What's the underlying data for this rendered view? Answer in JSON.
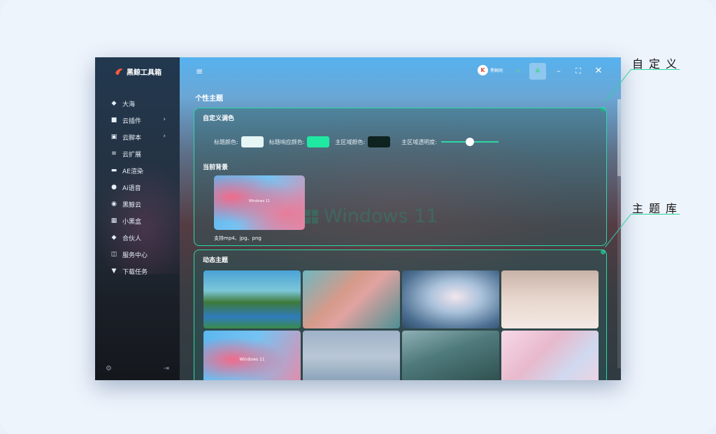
{
  "app": {
    "logo_text": "黑鲸工具箱",
    "brand_badge": "黑鲸网"
  },
  "sidebar": {
    "items": [
      {
        "label": "大海",
        "icon": "fish-icon"
      },
      {
        "label": "云插件",
        "icon": "cube-icon",
        "has_submenu": true
      },
      {
        "label": "云脚本",
        "icon": "code-icon",
        "has_submenu": true
      },
      {
        "label": "云扩展",
        "icon": "layers-icon"
      },
      {
        "label": "AE渲染",
        "icon": "render-icon"
      },
      {
        "label": "Ai语音",
        "icon": "voice-icon"
      },
      {
        "label": "黑鲸云",
        "icon": "cloud-circle-icon"
      },
      {
        "label": "小黑盒",
        "icon": "grid-icon"
      },
      {
        "label": "合伙人",
        "icon": "diamond-icon"
      },
      {
        "label": "服务中心",
        "icon": "service-icon"
      },
      {
        "label": "下载任务",
        "icon": "download-icon"
      }
    ]
  },
  "main": {
    "page_title": "个性主题",
    "custom_panel": {
      "title": "自定义调色",
      "title_color_label": "标题颜色:",
      "title_hover_color_label": "标题响应颜色:",
      "main_area_color_label": "主区域颜色:",
      "main_area_opacity_label": "主区域透明度:",
      "opacity_value": 0.5,
      "current_bg_title": "当前背景",
      "current_bg_caption": "支持mp4、jpg、png",
      "current_bg_label": "Windows 11"
    },
    "library_panel": {
      "title": "动态主题",
      "thumb_label": "Windows 11"
    },
    "watermark": "Windows 11"
  },
  "annotations": {
    "custom": "自定义",
    "library": "主题库"
  },
  "colors": {
    "accent": "#29d9a4",
    "title_color": "#e6f6f5",
    "title_hover_color": "#1fe8a2",
    "main_area_color": "#0e221f"
  }
}
